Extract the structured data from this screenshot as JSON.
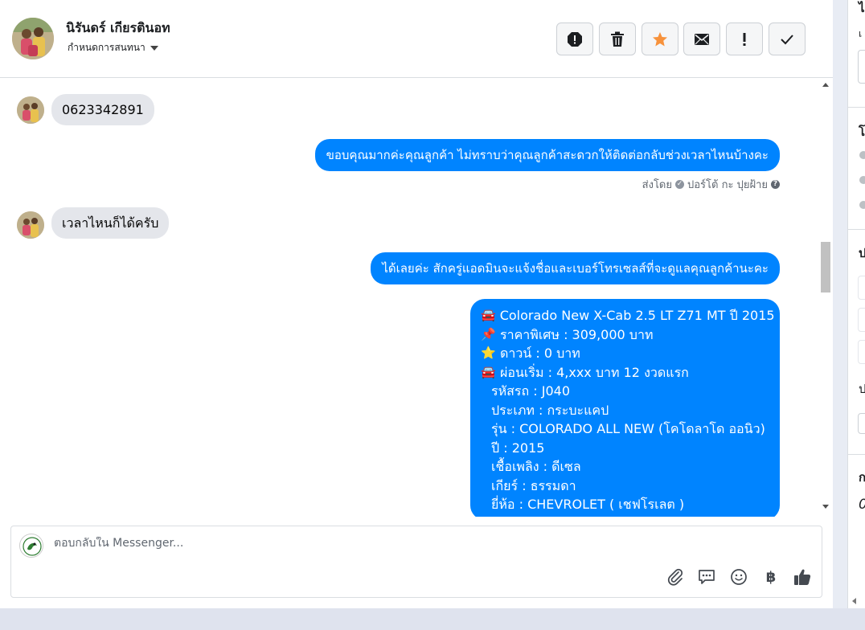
{
  "header": {
    "contact_name": "นิรันดร์ เกียรตินอท",
    "assign_label": "กำหนดการสนทนา",
    "actions": [
      {
        "name": "spam-button",
        "icon": "alert-octagon-icon"
      },
      {
        "name": "delete-button",
        "icon": "trash-icon"
      },
      {
        "name": "star-button",
        "icon": "star-icon"
      },
      {
        "name": "mark-unread-button",
        "icon": "envelope-icon"
      },
      {
        "name": "follow-up-button",
        "icon": "exclamation-icon"
      },
      {
        "name": "mark-done-button",
        "icon": "check-icon"
      }
    ],
    "star_color": "#f7923b"
  },
  "messages": {
    "m1": "0623342891",
    "m2": "ขอบคุณมากค่ะคุณลูกค้า ไม่ทราบว่าคุณลูกค้าสะดวกให้ติดต่อกลับช่วงเวลาไหนบ้างคะ",
    "sent_by_prefix": "ส่งโดย",
    "sent_by_name": "ปอร์โต้ กะ ปุยฝ้าย",
    "m3": "เวลาไหนก็ได้ครับ",
    "m4": "ได้เลยค่ะ สักครู่แอดมินจะแจ้งชื่อและเบอร์โทรเซลส์ที่จะดูแลคุณลูกค้านะคะ",
    "card": [
      {
        "emoji": "🚘",
        "text": "Colorado New X-Cab 2.5 LT Z71 MT ปี 2015"
      },
      {
        "emoji": "📌",
        "text": "ราคาพิเศษ : 309,000 บาท"
      },
      {
        "emoji": "⭐",
        "text": "ดาวน์ : 0 บาท"
      },
      {
        "emoji": "🚘",
        "text": "ผ่อนเริ่ม : 4,xxx บาท 12 งวดแรก"
      },
      {
        "emoji": "",
        "text": "รหัสรถ : J040"
      },
      {
        "emoji": "",
        "text": "ประเภท : กระบะแคป"
      },
      {
        "emoji": "",
        "text": "รุ่น : COLORADO ALL NEW (โคโดลาโด ออนิว)"
      },
      {
        "emoji": "",
        "text": "ปี : 2015"
      },
      {
        "emoji": "",
        "text": "เชื้อเพลิง : ดีเซล"
      },
      {
        "emoji": "",
        "text": "เกียร์ : ธรรมดา"
      },
      {
        "emoji": "",
        "text": "ยี่ห้อ : CHEVROLET ( เชฟโรเลต )"
      }
    ],
    "outgoing_color": "#0084ff",
    "incoming_color": "#e4e6eb"
  },
  "composer": {
    "placeholder": "ตอบกลับใน Messenger...",
    "tools": [
      "paperclip-icon",
      "saved-replies-icon",
      "emoji-icon",
      "baht-icon",
      "thumbs-up-icon"
    ]
  },
  "right_panel": {
    "glyphs": [
      "ไ",
      "เ",
      "โ",
      "ป",
      "ป",
      "ก",
      "0"
    ]
  }
}
